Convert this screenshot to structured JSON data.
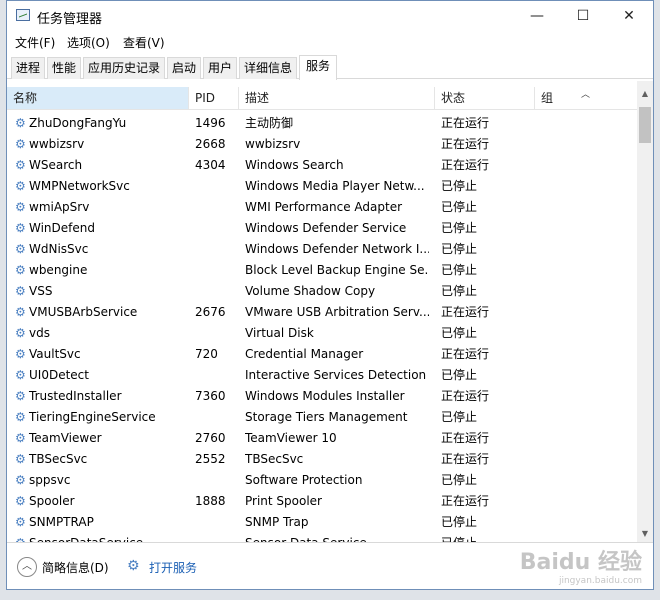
{
  "window": {
    "title": "任务管理器",
    "minimize_icon": "minimize-icon",
    "maximize_icon": "maximize-icon",
    "close_icon": "close-icon"
  },
  "menu": [
    {
      "label": "文件(F)"
    },
    {
      "label": "选项(O)"
    },
    {
      "label": "查看(V)"
    }
  ],
  "tabs": [
    {
      "label": "进程",
      "active": false
    },
    {
      "label": "性能",
      "active": false
    },
    {
      "label": "应用历史记录",
      "active": false
    },
    {
      "label": "启动",
      "active": false
    },
    {
      "label": "用户",
      "active": false
    },
    {
      "label": "详细信息",
      "active": false
    },
    {
      "label": "服务",
      "active": true
    }
  ],
  "table": {
    "columns": {
      "name": "名称",
      "pid": "PID",
      "desc": "描述",
      "status": "状态",
      "group": "组"
    },
    "sort_column": "name",
    "rows": [
      {
        "name": "ZhuDongFangYu",
        "pid": "1496",
        "desc": "主动防御",
        "status": "正在运行",
        "group": ""
      },
      {
        "name": "wwbizsrv",
        "pid": "2668",
        "desc": "wwbizsrv",
        "status": "正在运行",
        "group": ""
      },
      {
        "name": "WSearch",
        "pid": "4304",
        "desc": "Windows Search",
        "status": "正在运行",
        "group": ""
      },
      {
        "name": "WMPNetworkSvc",
        "pid": "",
        "desc": "Windows Media Player Netw...",
        "status": "已停止",
        "group": ""
      },
      {
        "name": "wmiApSrv",
        "pid": "",
        "desc": "WMI Performance Adapter",
        "status": "已停止",
        "group": ""
      },
      {
        "name": "WinDefend",
        "pid": "",
        "desc": "Windows Defender Service",
        "status": "已停止",
        "group": ""
      },
      {
        "name": "WdNisSvc",
        "pid": "",
        "desc": "Windows Defender Network I...",
        "status": "已停止",
        "group": ""
      },
      {
        "name": "wbengine",
        "pid": "",
        "desc": "Block Level Backup Engine Se...",
        "status": "已停止",
        "group": ""
      },
      {
        "name": "VSS",
        "pid": "",
        "desc": "Volume Shadow Copy",
        "status": "已停止",
        "group": ""
      },
      {
        "name": "VMUSBArbService",
        "pid": "2676",
        "desc": "VMware USB Arbitration Serv...",
        "status": "正在运行",
        "group": ""
      },
      {
        "name": "vds",
        "pid": "",
        "desc": "Virtual Disk",
        "status": "已停止",
        "group": ""
      },
      {
        "name": "VaultSvc",
        "pid": "720",
        "desc": "Credential Manager",
        "status": "正在运行",
        "group": ""
      },
      {
        "name": "UI0Detect",
        "pid": "",
        "desc": "Interactive Services Detection",
        "status": "已停止",
        "group": ""
      },
      {
        "name": "TrustedInstaller",
        "pid": "7360",
        "desc": "Windows Modules Installer",
        "status": "正在运行",
        "group": ""
      },
      {
        "name": "TieringEngineService",
        "pid": "",
        "desc": "Storage Tiers Management",
        "status": "已停止",
        "group": ""
      },
      {
        "name": "TeamViewer",
        "pid": "2760",
        "desc": "TeamViewer 10",
        "status": "正在运行",
        "group": ""
      },
      {
        "name": "TBSecSvc",
        "pid": "2552",
        "desc": "TBSecSvc",
        "status": "正在运行",
        "group": ""
      },
      {
        "name": "sppsvc",
        "pid": "",
        "desc": "Software Protection",
        "status": "已停止",
        "group": ""
      },
      {
        "name": "Spooler",
        "pid": "1888",
        "desc": "Print Spooler",
        "status": "正在运行",
        "group": ""
      },
      {
        "name": "SNMPTRAP",
        "pid": "",
        "desc": "SNMP Trap",
        "status": "已停止",
        "group": ""
      },
      {
        "name": "SensorDataService",
        "pid": "",
        "desc": "Sensor Data Service",
        "status": "已停止",
        "group": ""
      }
    ]
  },
  "footer": {
    "less_details": "简略信息(D)",
    "open_services": "打开服务"
  },
  "watermark": {
    "logo": "Baidu 经验",
    "sub": "jingyan.baidu.com"
  },
  "colors": {
    "accent": "#1a5fb4",
    "sorted_header": "#d9ebf9"
  }
}
